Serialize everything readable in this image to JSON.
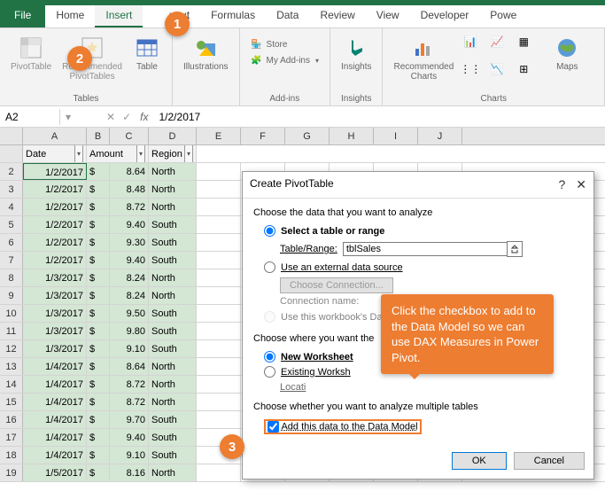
{
  "tabs": {
    "file": "File",
    "home": "Home",
    "insert": "Insert",
    "pagelayout": "yout",
    "formulas": "Formulas",
    "data": "Data",
    "review": "Review",
    "view": "View",
    "developer": "Developer",
    "power": "Powe"
  },
  "ribbon": {
    "tables": {
      "pivottable": "PivotTable",
      "recommended": "Recommended\nPivotTables",
      "table": "Table",
      "group": "Tables"
    },
    "illustrations": {
      "label": "Illustrations",
      "group": ""
    },
    "addins": {
      "store": "Store",
      "myaddins": "My Add-ins",
      "group": "Add-ins"
    },
    "insights": {
      "label": "Insights",
      "group": "Insights"
    },
    "charts": {
      "recommended": "Recommended\nCharts",
      "group": "Charts"
    },
    "maps": {
      "label": "Maps"
    }
  },
  "namebox": "A2",
  "formula": "1/2/2017",
  "columns": [
    "A",
    "B",
    "C",
    "D",
    "E",
    "F",
    "G",
    "H",
    "I",
    "J"
  ],
  "headers": {
    "date": "Date",
    "amount": "Amount",
    "region": "Region"
  },
  "rows": [
    {
      "n": 2,
      "date": "1/2/2017",
      "cur": "$",
      "amt": "8.64",
      "region": "North"
    },
    {
      "n": 3,
      "date": "1/2/2017",
      "cur": "$",
      "amt": "8.48",
      "region": "North"
    },
    {
      "n": 4,
      "date": "1/2/2017",
      "cur": "$",
      "amt": "8.72",
      "region": "North"
    },
    {
      "n": 5,
      "date": "1/2/2017",
      "cur": "$",
      "amt": "9.40",
      "region": "South"
    },
    {
      "n": 6,
      "date": "1/2/2017",
      "cur": "$",
      "amt": "9.30",
      "region": "South"
    },
    {
      "n": 7,
      "date": "1/2/2017",
      "cur": "$",
      "amt": "9.40",
      "region": "South"
    },
    {
      "n": 8,
      "date": "1/3/2017",
      "cur": "$",
      "amt": "8.24",
      "region": "North"
    },
    {
      "n": 9,
      "date": "1/3/2017",
      "cur": "$",
      "amt": "8.24",
      "region": "North"
    },
    {
      "n": 10,
      "date": "1/3/2017",
      "cur": "$",
      "amt": "9.50",
      "region": "South"
    },
    {
      "n": 11,
      "date": "1/3/2017",
      "cur": "$",
      "amt": "9.80",
      "region": "South"
    },
    {
      "n": 12,
      "date": "1/3/2017",
      "cur": "$",
      "amt": "9.10",
      "region": "South"
    },
    {
      "n": 13,
      "date": "1/4/2017",
      "cur": "$",
      "amt": "8.64",
      "region": "North"
    },
    {
      "n": 14,
      "date": "1/4/2017",
      "cur": "$",
      "amt": "8.72",
      "region": "North"
    },
    {
      "n": 15,
      "date": "1/4/2017",
      "cur": "$",
      "amt": "8.72",
      "region": "North"
    },
    {
      "n": 16,
      "date": "1/4/2017",
      "cur": "$",
      "amt": "9.70",
      "region": "South"
    },
    {
      "n": 17,
      "date": "1/4/2017",
      "cur": "$",
      "amt": "9.40",
      "region": "South"
    },
    {
      "n": 18,
      "date": "1/4/2017",
      "cur": "$",
      "amt": "9.10",
      "region": "South"
    },
    {
      "n": 19,
      "date": "1/5/2017",
      "cur": "$",
      "amt": "8.16",
      "region": "North"
    }
  ],
  "dialog": {
    "title": "Create PivotTable",
    "s1": "Choose the data that you want to analyze",
    "opt_select": "Select a table or range",
    "table_range_lbl": "Table/Range:",
    "table_range_val": "tblSales",
    "opt_external": "Use an external data source",
    "choose_conn": "Choose Connection...",
    "conn_name": "Connection name:",
    "opt_workbook": "Use this workbook's Da",
    "s2": "Choose where you want the",
    "opt_new": "New Worksheet",
    "opt_existing": "Existing Worksh",
    "location_lbl": "Locati",
    "s3": "Choose whether you want to analyze multiple tables",
    "opt_datamodel": "Add this data to the Data Model",
    "ok": "OK",
    "cancel": "Cancel"
  },
  "callouts": {
    "c1": "1",
    "c2": "2",
    "c3": "3"
  },
  "tooltip": "Click the checkbox to add to the Data Model so we can use DAX Measures in Power Pivot."
}
